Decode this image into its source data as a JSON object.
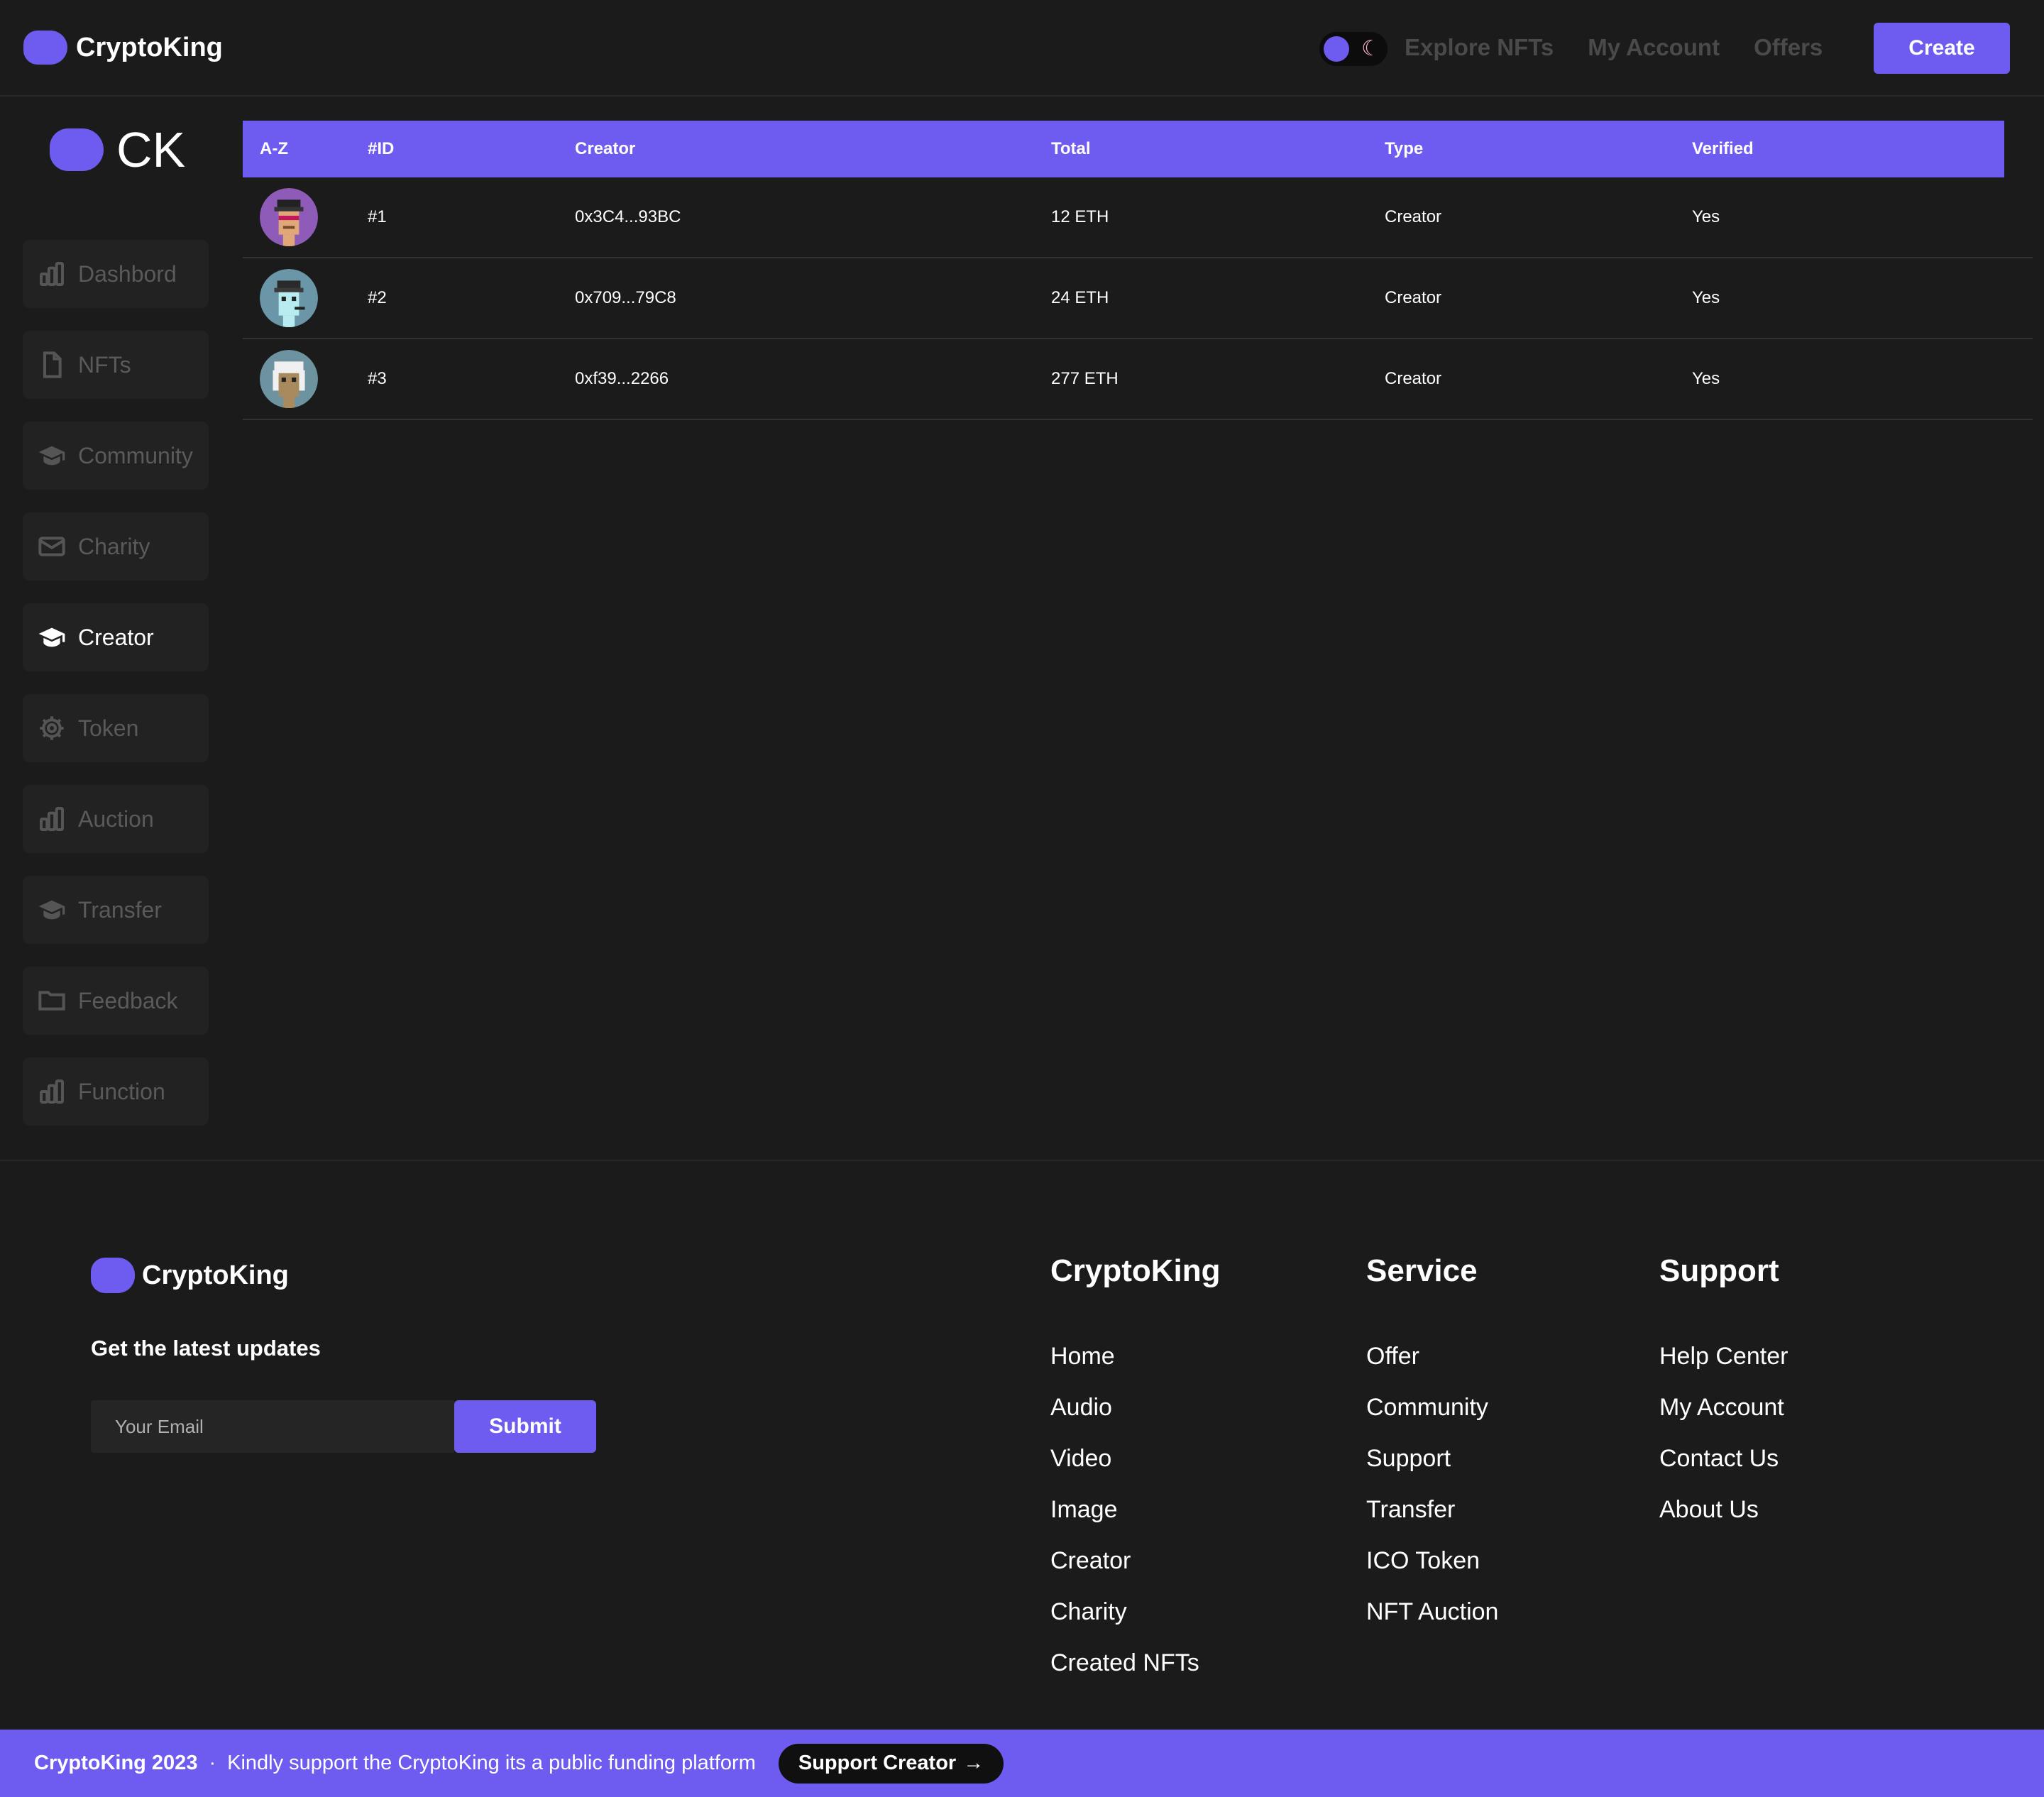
{
  "navbar": {
    "brand": "CryptoKing",
    "links": [
      "Explore NFTs",
      "My Account",
      "Offers"
    ],
    "create_label": "Create"
  },
  "sidebar": {
    "logo_text": "CK",
    "items": [
      {
        "label": "Dashbord",
        "icon": "bar-chart-icon",
        "active": false
      },
      {
        "label": "NFTs",
        "icon": "file-icon",
        "active": false
      },
      {
        "label": "Community",
        "icon": "graduation-cap-icon",
        "active": false
      },
      {
        "label": "Charity",
        "icon": "mail-icon",
        "active": false
      },
      {
        "label": "Creator",
        "icon": "graduation-cap-icon",
        "active": true
      },
      {
        "label": "Token",
        "icon": "gear-icon",
        "active": false
      },
      {
        "label": "Auction",
        "icon": "bar-chart-icon",
        "active": false
      },
      {
        "label": "Transfer",
        "icon": "graduation-cap-icon",
        "active": false
      },
      {
        "label": "Feedback",
        "icon": "folder-icon",
        "active": false
      },
      {
        "label": "Function",
        "icon": "bar-chart-icon",
        "active": false
      }
    ]
  },
  "table": {
    "headers": [
      "A-Z",
      "#ID",
      "Creator",
      "Total",
      "Type",
      "Verified"
    ],
    "rows": [
      {
        "id": "#1",
        "creator": "0x3C4...93BC",
        "total": "12 ETH",
        "type": "Creator",
        "verified": "Yes",
        "avatar_bg": "#8e5bb8"
      },
      {
        "id": "#2",
        "creator": "0x709...79C8",
        "total": "24 ETH",
        "type": "Creator",
        "verified": "Yes",
        "avatar_bg": "#6a96a8"
      },
      {
        "id": "#3",
        "creator": "0xf39...2266",
        "total": "277 ETH",
        "type": "Creator",
        "verified": "Yes",
        "avatar_bg": "#6d93a0"
      }
    ]
  },
  "footer": {
    "brand": "CryptoKing",
    "updates_heading": "Get the latest updates",
    "email_placeholder": "Your Email",
    "submit_label": "Submit",
    "columns": [
      {
        "title": "CryptoKing",
        "links": [
          "Home",
          "Audio",
          "Video",
          "Image",
          "Creator",
          "Charity",
          "Created NFTs"
        ]
      },
      {
        "title": "Service",
        "links": [
          "Offer",
          "Community",
          "Support",
          "Transfer",
          "ICO Token",
          "NFT Auction"
        ]
      },
      {
        "title": "Support",
        "links": [
          "Help Center",
          "My Account",
          "Contact Us",
          "About Us"
        ]
      }
    ]
  },
  "bottom_bar": {
    "year_text": "CryptoKing 2023",
    "separator": "·",
    "message": "Kindly support the CryptoKing its a public funding platform",
    "button_label": "Support Creator"
  },
  "colors": {
    "accent": "#6e5cf0",
    "background": "#1b1b1b",
    "sidebar_item": "#222222"
  }
}
